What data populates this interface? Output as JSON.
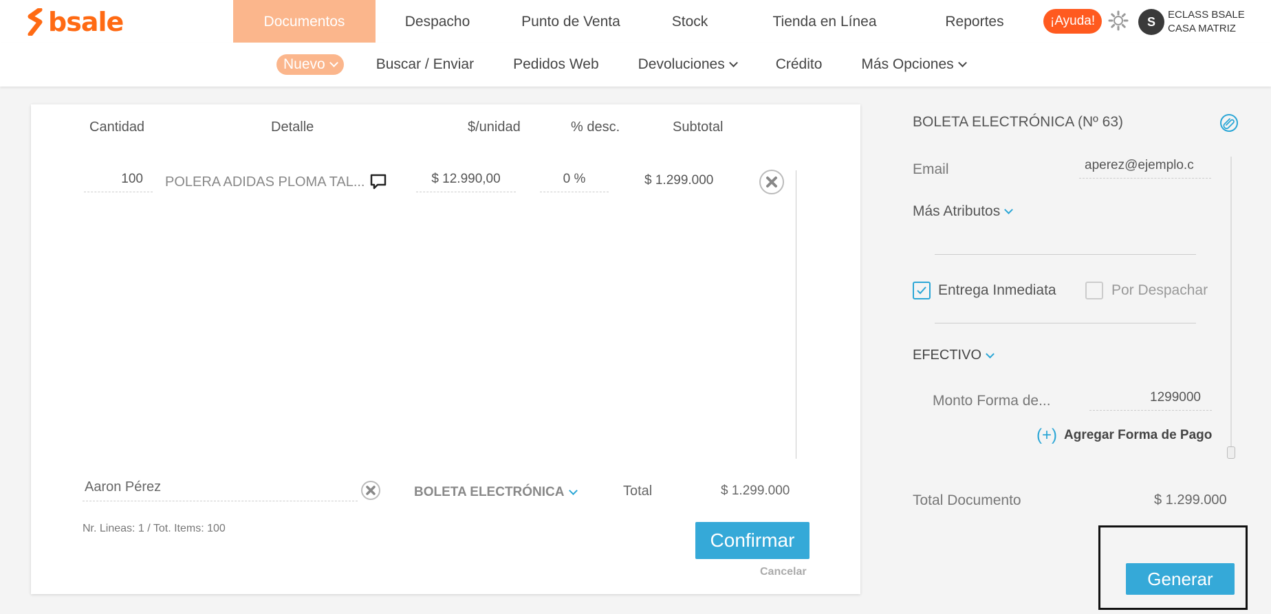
{
  "brand": {
    "logo_text": "bsale",
    "accent": "#ff6a13",
    "nav_active_bg": "#fbb68c",
    "primary_button": "#35a9d8"
  },
  "nav": {
    "items": [
      "Documentos",
      "Despacho",
      "Punto de Venta",
      "Stock",
      "Tienda en Línea",
      "Reportes"
    ],
    "help_label": "¡Ayuda!",
    "avatar_initial": "S",
    "account_line1": "ECLASS BSALE",
    "account_line2": "CASA MATRIZ"
  },
  "subnav": {
    "items": [
      "Nuevo",
      "Buscar / Enviar",
      "Pedidos Web",
      "Devoluciones",
      "Crédito",
      "Más Opciones"
    ]
  },
  "table": {
    "headers": {
      "qty": "Cantidad",
      "detail": "Detalle",
      "unit": "$/unidad",
      "disc": "% desc.",
      "subtotal": "Subtotal"
    },
    "rows": [
      {
        "qty": "100",
        "detail": "POLERA ADIDAS PLOMA TAL...",
        "unit": "$ 12.990,00",
        "disc": "0 %",
        "subtotal": "$ 1.299.000"
      }
    ]
  },
  "footer": {
    "client": "Aaron Pérez",
    "doc_type": "BOLETA ELECTRÓNICA",
    "total_label": "Total",
    "total_value": "$ 1.299.000",
    "summary": "Nr. Lineas: 1 / Tot. Items: 100",
    "confirm_label": "Confirmar",
    "cancel_label": "Cancelar"
  },
  "panel": {
    "title": "BOLETA ELECTRÓNICA (Nº 63)",
    "email_label": "Email",
    "email_value": "aperez@ejemplo.c",
    "more_attrs": "Más Atributos",
    "delivery_now": "Entrega Inmediata",
    "delivery_now_checked": true,
    "to_dispatch": "Por Despachar",
    "to_dispatch_checked": false,
    "payment_method": "EFECTIVO",
    "amount_label": "Monto Forma de...",
    "amount_value": "1299000",
    "add_payment": "Agregar Forma de Pago",
    "total_doc_label": "Total Documento",
    "total_doc_value": "$ 1.299.000",
    "generate_label": "Generar"
  }
}
